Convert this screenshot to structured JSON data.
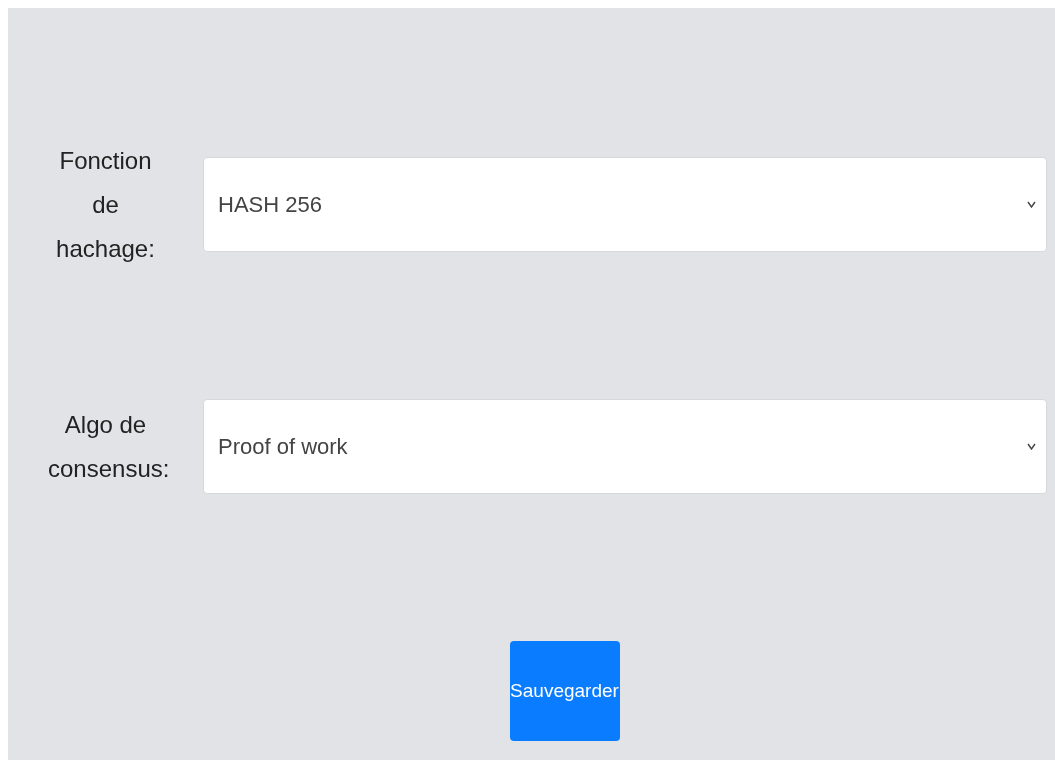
{
  "fields": [
    {
      "label": "Fonction de hachage:",
      "value": "HASH 256"
    },
    {
      "label": "Algo de consensus:",
      "value": "Proof of work"
    }
  ],
  "save_button": "Sauvegarder"
}
